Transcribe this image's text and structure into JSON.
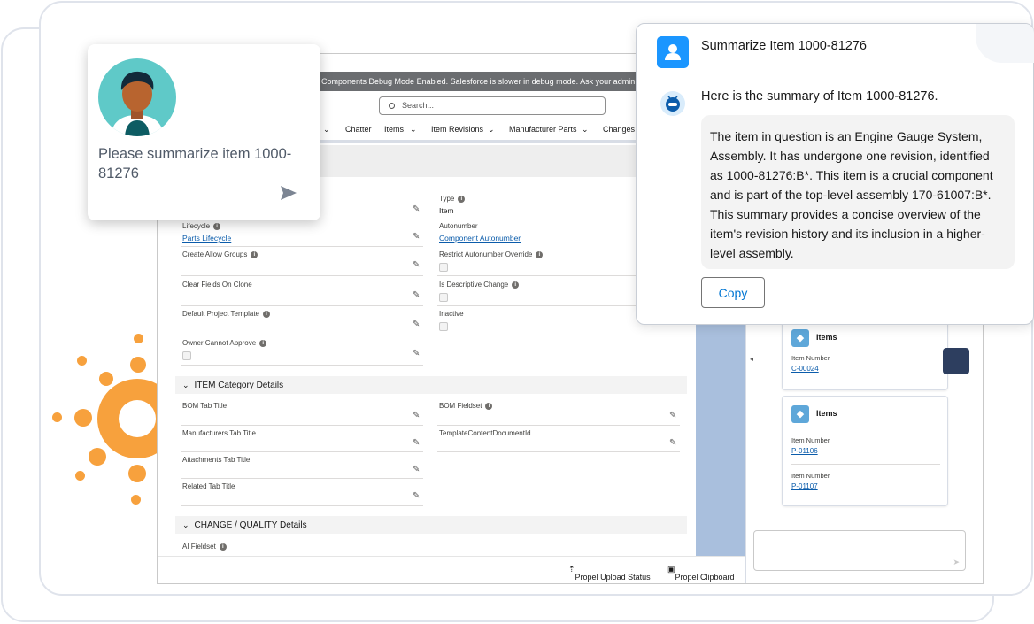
{
  "debug_banner": "Components Debug Mode Enabled. Salesforce is slower in debug mode. Ask your admin how",
  "search": {
    "placeholder": "Search..."
  },
  "nav": {
    "items": [
      "Chatter",
      "Items",
      "Item Revisions",
      "Manufacturer Parts",
      "Changes"
    ]
  },
  "form": {
    "type_label": "Type",
    "type_value": "Item",
    "lifecycle_label": "Lifecycle",
    "lifecycle_value": "Parts Lifecycle",
    "autonumber_label": "Autonumber",
    "autonumber_value": "Component Autonumber",
    "create_allow_groups_label": "Create Allow Groups",
    "restrict_autonumber_label": "Restrict Autonumber Override",
    "clear_fields_label": "Clear Fields On Clone",
    "is_descriptive_label": "Is Descriptive Change",
    "default_project_label": "Default Project Template",
    "inactive_label": "Inactive",
    "owner_cannot_approve_label": "Owner Cannot Approve"
  },
  "sections": {
    "item_category": "ITEM Category Details",
    "change_quality": "CHANGE / QUALITY Details"
  },
  "category_fields": {
    "bom_tab_title": "BOM Tab Title",
    "bom_fieldset": "BOM Fieldset",
    "manufacturers_tab_title": "Manufacturers Tab Title",
    "template_content": "TemplateContentDocumentId",
    "attachments_tab_title": "Attachments Tab Title",
    "related_tab_title": "Related Tab Title"
  },
  "change_fields": {
    "ai_fieldset": "AI Fieldset"
  },
  "footer": {
    "upload_status": "Propel Upload Status",
    "clipboard": "Propel Clipboard"
  },
  "related_cards": [
    {
      "title": "Items",
      "rows": [
        {
          "label": "Item Number",
          "value": "C-00024"
        }
      ]
    },
    {
      "title": "Items",
      "rows": [
        {
          "label": "Item Number",
          "value": "P-01106"
        },
        {
          "label": "Item Number",
          "value": "P-01107"
        }
      ]
    }
  ],
  "prompt": {
    "text": "Please summarize item 1000-81276"
  },
  "summary": {
    "question": "Summarize Item 1000-81276",
    "answer_intro": "Here is the summary of Item 1000-81276.",
    "answer_body": "The item in question is an Engine Gauge System, Assembly. It has undergone one revision, identified as 1000-81276:B*. This item is a crucial component and is part of the top-level assembly 170-61007:B*. This summary provides a concise overview of the item's revision history and its inclusion in a higher-level assembly.",
    "copy_label": "Copy"
  },
  "icons": {
    "user": "user-icon",
    "bot": "bot-icon",
    "send": "send-icon",
    "search": "search-icon",
    "pencil": "pencil-icon",
    "info": "info-icon",
    "cube": "cube-icon"
  },
  "colors": {
    "accent_blue": "#1b96ff",
    "link_blue": "#0b5cab",
    "decoration_orange": "#f7a13d",
    "avatar_teal": "#5fc9c8"
  }
}
